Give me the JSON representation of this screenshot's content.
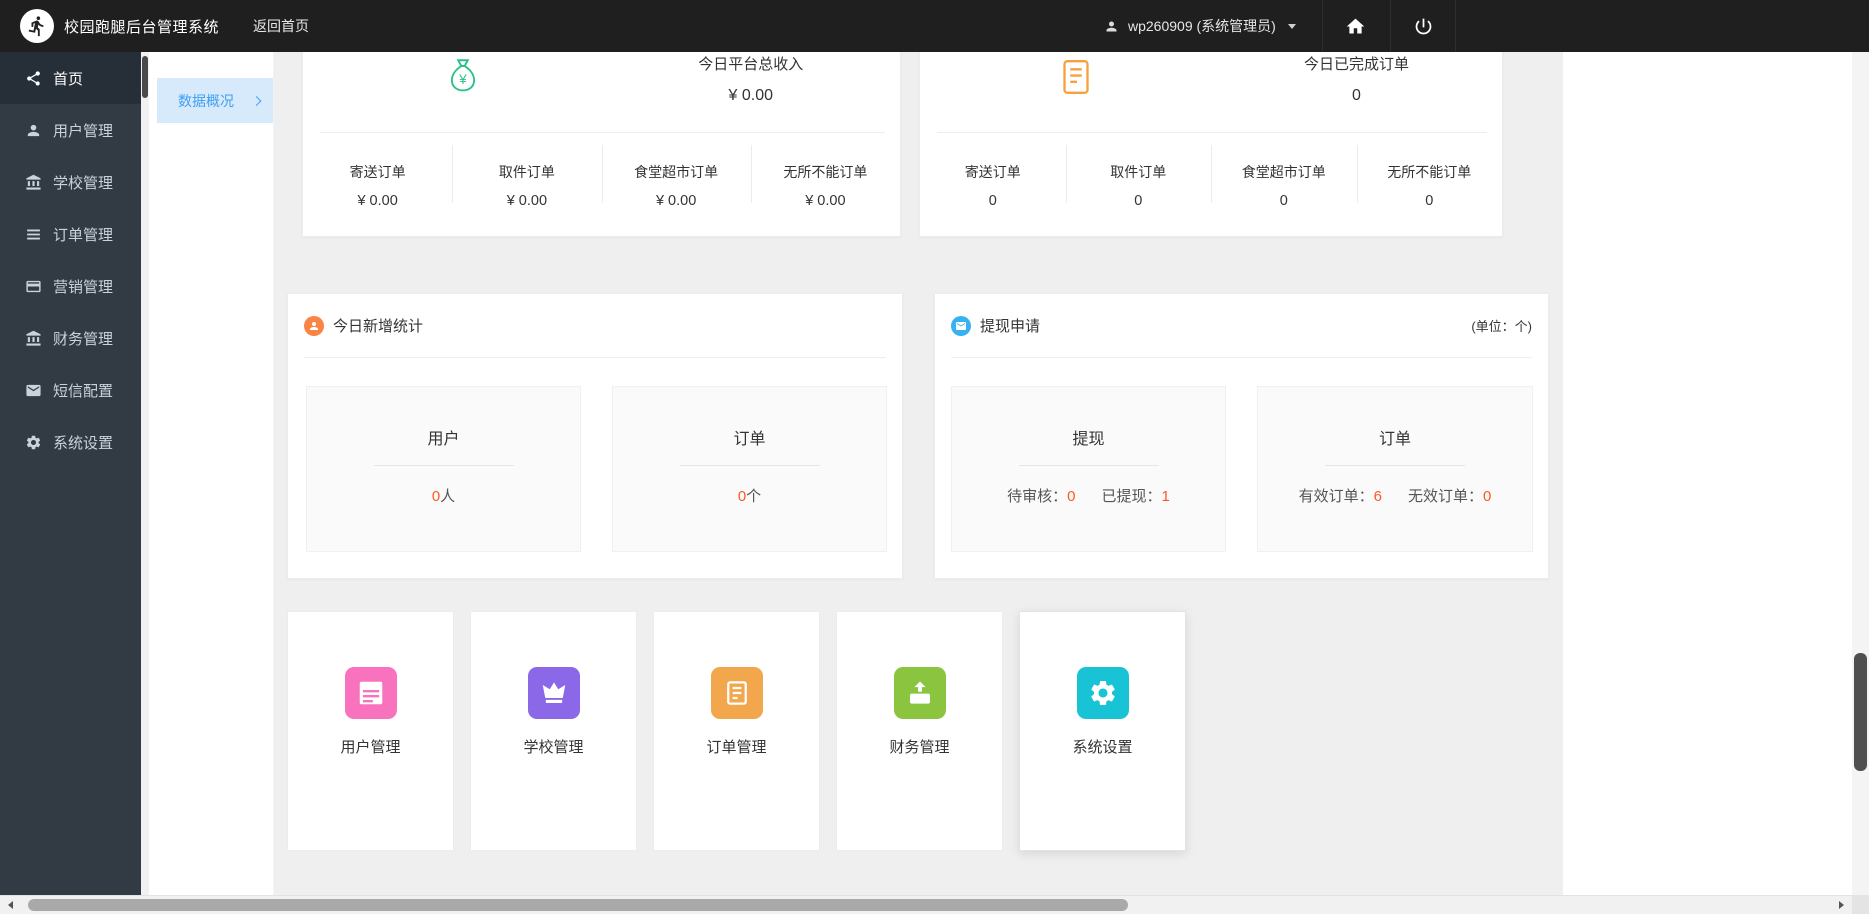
{
  "colors": {
    "topbar-bg": "#1f1f1f",
    "sidebar-bg": "#323a44",
    "sidebar-active-bg": "#262e38",
    "subnav-active-bg": "#d7eafc",
    "subnav-active-fg": "#3f9ff2",
    "main-bg": "#efefef",
    "accent-red": "#ff5722",
    "icon-green": "#2cc287",
    "icon-orange": "#f7a03c",
    "hdr-orange": "#fa8443",
    "hdr-blue": "#38b1f0"
  },
  "topbar": {
    "title": "校园跑腿后台管理系统",
    "back_home": "返回首页",
    "user": "wp260909 (系统管理员)"
  },
  "sidebar": {
    "items": [
      {
        "label": "首页",
        "icon": "share-icon",
        "active": true
      },
      {
        "label": "用户管理",
        "icon": "user-icon"
      },
      {
        "label": "学校管理",
        "icon": "bank-icon"
      },
      {
        "label": "订单管理",
        "icon": "list-icon"
      },
      {
        "label": "营销管理",
        "icon": "card-icon"
      },
      {
        "label": "财务管理",
        "icon": "bank-icon"
      },
      {
        "label": "短信配置",
        "icon": "mail-icon"
      },
      {
        "label": "系统设置",
        "icon": "gear-icon"
      }
    ]
  },
  "subnav": {
    "items": [
      {
        "label": "数据概况"
      }
    ]
  },
  "overview": {
    "income": {
      "title": "今日平台总收入",
      "value": "¥ 0.00",
      "stats": [
        {
          "label": "寄送订单",
          "value": "¥ 0.00"
        },
        {
          "label": "取件订单",
          "value": "¥ 0.00"
        },
        {
          "label": "食堂超市订单",
          "value": "¥ 0.00"
        },
        {
          "label": "无所不能订单",
          "value": "¥ 0.00"
        }
      ]
    },
    "completed": {
      "title": "今日已完成订单",
      "value": "0",
      "stats": [
        {
          "label": "寄送订单",
          "value": "0"
        },
        {
          "label": "取件订单",
          "value": "0"
        },
        {
          "label": "食堂超市订单",
          "value": "0"
        },
        {
          "label": "无所不能订单",
          "value": "0"
        }
      ]
    }
  },
  "today_new": {
    "title": "今日新增统计",
    "boxes": [
      {
        "title": "用户",
        "value": "0",
        "unit": "人"
      },
      {
        "title": "订单",
        "value": "0",
        "unit": "个"
      }
    ]
  },
  "withdraw": {
    "title": "提现申请",
    "unit_note": "(单位：个)",
    "boxes": [
      {
        "title": "提现",
        "stats": [
          {
            "label": "待审核：",
            "value": "0"
          },
          {
            "label": "已提现：",
            "value": "1"
          }
        ]
      },
      {
        "title": "订单",
        "stats": [
          {
            "label": "有效订单：",
            "value": "6"
          },
          {
            "label": "无效订单：",
            "value": "0"
          }
        ]
      }
    ]
  },
  "shortcuts": [
    {
      "label": "用户管理",
      "color": "#f872be"
    },
    {
      "label": "学校管理",
      "color": "#8a68e8"
    },
    {
      "label": "订单管理",
      "color": "#f3a74d"
    },
    {
      "label": "财务管理",
      "color": "#8bc53f"
    },
    {
      "label": "系统设置",
      "color": "#19c3d6"
    }
  ]
}
